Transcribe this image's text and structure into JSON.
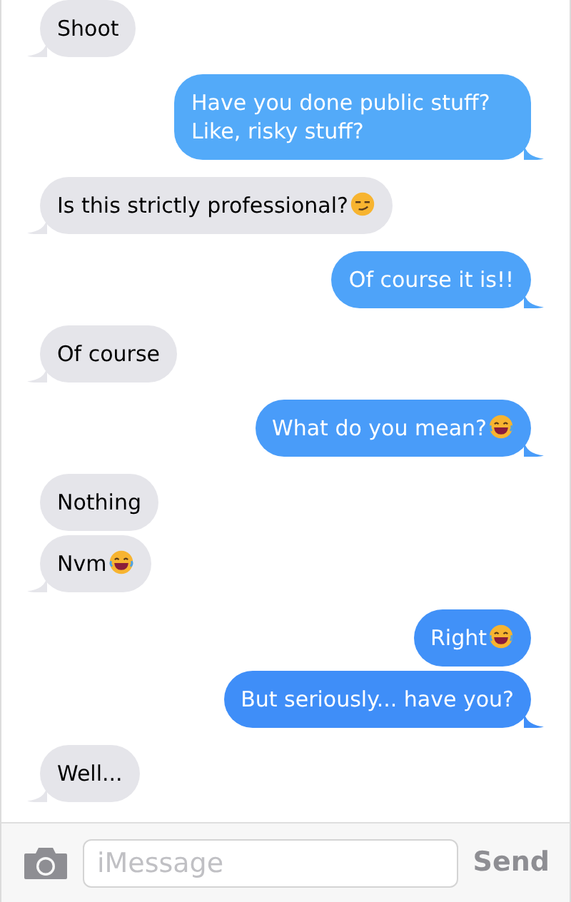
{
  "messages": [
    {
      "kind": "received",
      "text": "Shoot",
      "tail": true
    },
    {
      "kind": "sent",
      "text": "Have you done public stuff? Like, risky stuff?",
      "tail": true
    },
    {
      "kind": "received",
      "text": "Is this strictly professional?",
      "emoji": {
        "kind": "smirk"
      },
      "tail": true
    },
    {
      "kind": "sent",
      "text": "Of course it is!!",
      "tail": true
    },
    {
      "kind": "received",
      "text": "Of course",
      "tail": true
    },
    {
      "kind": "sent",
      "text": "What do you mean?",
      "emoji": {
        "kind": "laugh"
      },
      "tail": true
    },
    {
      "kind": "received",
      "text": "Nothing",
      "tail": false
    },
    {
      "kind": "received",
      "text": "Nvm",
      "emoji": {
        "kind": "laugh"
      },
      "tail": true
    },
    {
      "kind": "sent",
      "text": "Right",
      "emoji": {
        "kind": "laugh"
      },
      "tail": false
    },
    {
      "kind": "sent",
      "text": "But seriously... have you?",
      "tail": true
    },
    {
      "kind": "received",
      "text": "Well...",
      "tail": true
    }
  ],
  "composer": {
    "placeholder": "iMessage",
    "send": "Send"
  }
}
